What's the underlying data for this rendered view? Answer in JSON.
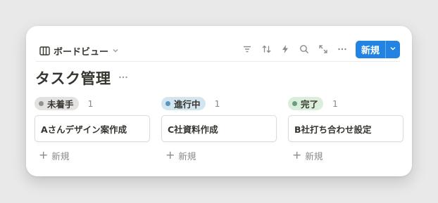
{
  "toolbar": {
    "view_label": "ボードビュー",
    "view_icon": "board-icon",
    "tools": [
      {
        "name": "filter-icon"
      },
      {
        "name": "sort-icon"
      },
      {
        "name": "automation-icon"
      },
      {
        "name": "search-icon"
      },
      {
        "name": "expand-icon"
      },
      {
        "name": "more-icon"
      }
    ],
    "new_button_label": "新規"
  },
  "page": {
    "title": "タスク管理"
  },
  "columns": [
    {
      "status": "未着手",
      "count": "1",
      "pill_color": "#e3e2e0",
      "dot_color": "#91918e",
      "cards": [
        {
          "title": "Aさんデザイン案作成"
        }
      ],
      "add_label": "新規"
    },
    {
      "status": "進行中",
      "count": "1",
      "pill_color": "#d3e5ef",
      "dot_color": "#5b97bd",
      "cards": [
        {
          "title": "C社資料作成"
        }
      ],
      "add_label": "新規"
    },
    {
      "status": "完了",
      "count": "1",
      "pill_color": "#dbeddb",
      "dot_color": "#6c9b7d",
      "cards": [
        {
          "title": "B社打ち合わせ設定"
        }
      ],
      "add_label": "新規"
    }
  ]
}
